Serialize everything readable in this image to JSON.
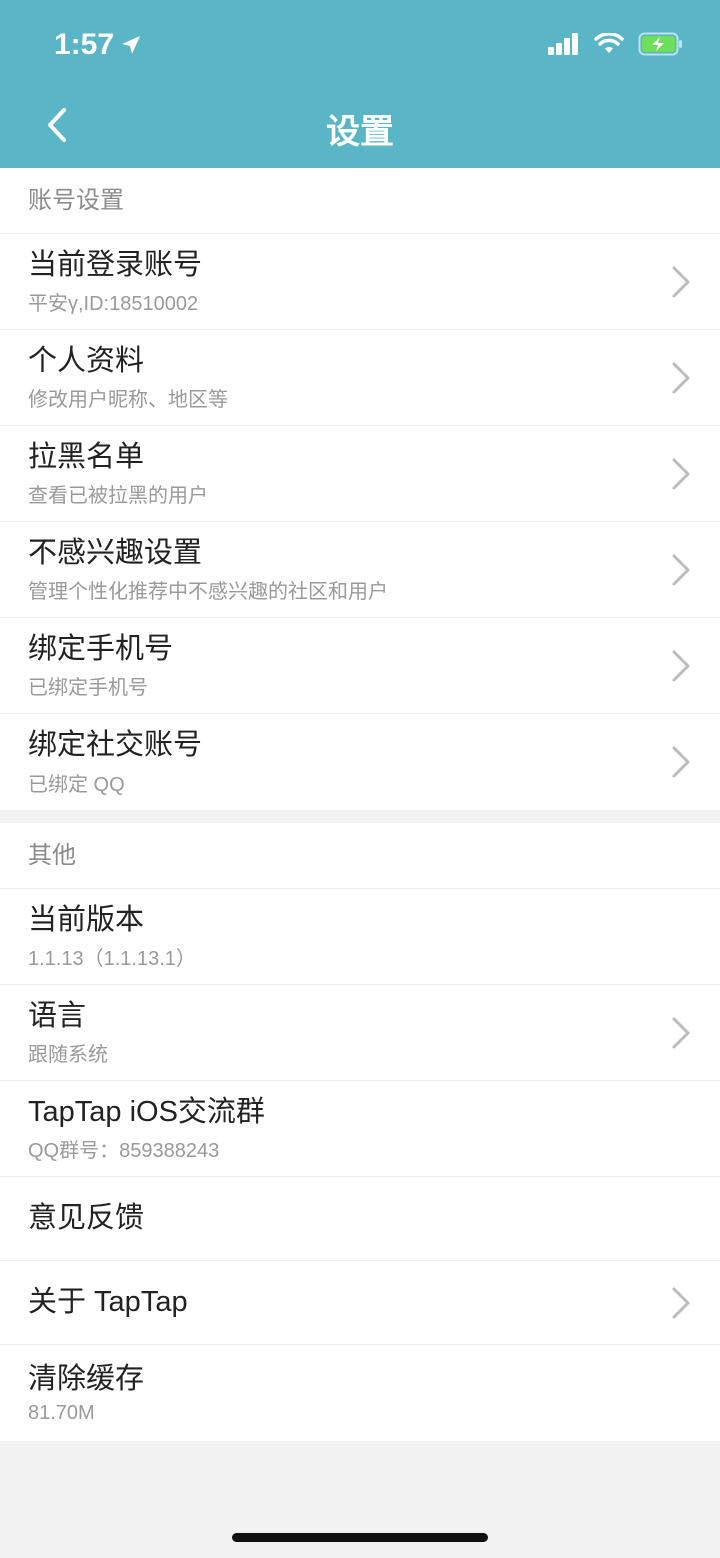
{
  "status": {
    "time": "1:57"
  },
  "header": {
    "title": "设置"
  },
  "sections": [
    {
      "title": "账号设置",
      "items": [
        {
          "title": "当前登录账号",
          "subtitle": "平安γ,ID:18510002",
          "chevron": true
        },
        {
          "title": "个人资料",
          "subtitle": "修改用户昵称、地区等",
          "chevron": true
        },
        {
          "title": "拉黑名单",
          "subtitle": "查看已被拉黑的用户",
          "chevron": true
        },
        {
          "title": "不感兴趣设置",
          "subtitle": "管理个性化推荐中不感兴趣的社区和用户",
          "chevron": true
        },
        {
          "title": "绑定手机号",
          "subtitle": "已绑定手机号",
          "chevron": true
        },
        {
          "title": "绑定社交账号",
          "subtitle": "已绑定 QQ",
          "chevron": true
        }
      ]
    },
    {
      "title": "其他",
      "items": [
        {
          "title": "当前版本",
          "subtitle": "1.1.13（1.1.13.1）",
          "chevron": false
        },
        {
          "title": "语言",
          "subtitle": "跟随系统",
          "chevron": true
        },
        {
          "title": "TapTap iOS交流群",
          "subtitle": "QQ群号：859388243",
          "chevron": false
        },
        {
          "title": "意见反馈",
          "subtitle": "",
          "chevron": false
        },
        {
          "title": "关于 TapTap",
          "subtitle": "",
          "chevron": true
        },
        {
          "title": "清除缓存",
          "subtitle": "81.70M",
          "chevron": false
        }
      ]
    }
  ],
  "colors": {
    "header_bg": "#5ab6c7",
    "battery": "#6ce05a"
  },
  "icons": [
    "location-arrow-icon",
    "signal-icon",
    "wifi-icon",
    "battery-charging-icon",
    "back-icon",
    "chevron-right-icon"
  ]
}
